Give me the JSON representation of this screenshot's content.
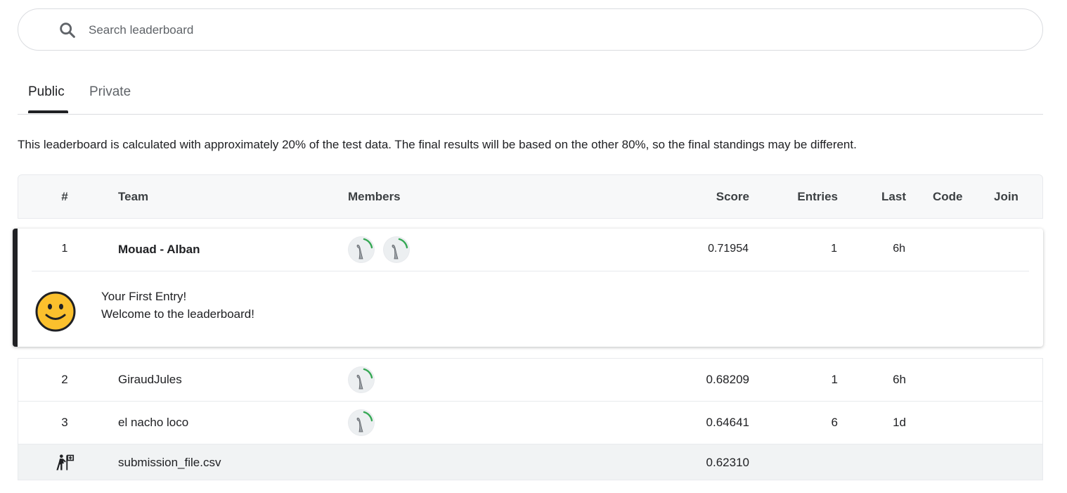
{
  "search": {
    "placeholder": "Search leaderboard"
  },
  "tabs": [
    {
      "label": "Public",
      "active": true
    },
    {
      "label": "Private",
      "active": false
    }
  ],
  "notice": "This leaderboard is calculated with approximately 20% of the test data. The final results will be based on the other 80%, so the final standings may be different.",
  "table": {
    "headers": {
      "rank": "#",
      "team": "Team",
      "members": "Members",
      "score": "Score",
      "entries": "Entries",
      "last": "Last",
      "code": "Code",
      "join": "Join"
    },
    "rows": [
      {
        "rank": "1",
        "team": "Mouad - Alban",
        "members": 2,
        "score": "0.71954",
        "entries": "1",
        "last": "6h"
      },
      {
        "rank": "2",
        "team": "GiraudJules",
        "members": 1,
        "score": "0.68209",
        "entries": "1",
        "last": "6h"
      },
      {
        "rank": "3",
        "team": "el nacho loco",
        "members": 1,
        "score": "0.64641",
        "entries": "6",
        "last": "1d"
      }
    ],
    "submission": {
      "icon": "benchmark-person-icon",
      "file": "submission_file.csv",
      "score": "0.62310"
    }
  },
  "welcome": {
    "icon": "smiley-icon",
    "line1": "Your First Entry!",
    "line2": "Welcome to the leaderboard!"
  },
  "colors": {
    "progress_ring": "#20beff",
    "accent_dark": "#202124",
    "ring_green": "#34a853"
  }
}
